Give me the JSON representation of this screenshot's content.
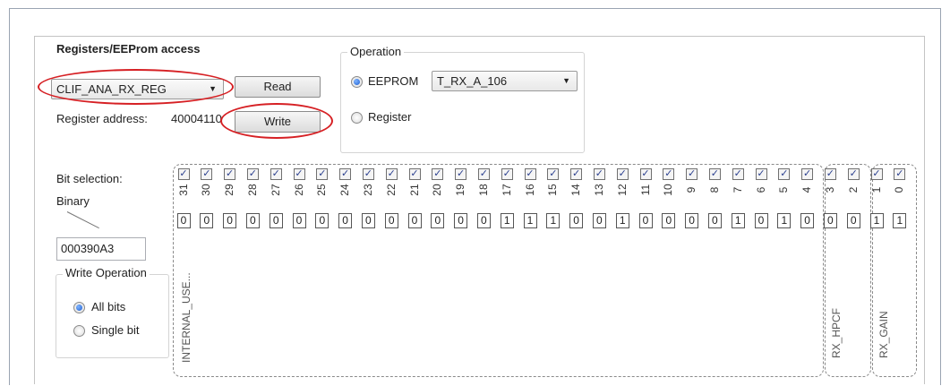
{
  "registers": {
    "title": "Registers/EEProm access",
    "register_select": "CLIF_ANA_RX_REG",
    "read_label": "Read",
    "write_label": "Write",
    "address_label": "Register address:",
    "address_value": "40004110"
  },
  "operation": {
    "legend": "Operation",
    "eeprom_label": "EEPROM",
    "eeprom_selected": true,
    "eeprom_select": "T_RX_A_106",
    "register_label": "Register",
    "register_selected": false
  },
  "bit_selection": {
    "label": "Bit selection:",
    "format_label": "Binary",
    "value": "000390A3",
    "bits": [
      {
        "n": "31",
        "v": "0",
        "checked": true
      },
      {
        "n": "30",
        "v": "0",
        "checked": true
      },
      {
        "n": "29",
        "v": "0",
        "checked": true
      },
      {
        "n": "28",
        "v": "0",
        "checked": true
      },
      {
        "n": "27",
        "v": "0",
        "checked": true
      },
      {
        "n": "26",
        "v": "0",
        "checked": true
      },
      {
        "n": "25",
        "v": "0",
        "checked": true
      },
      {
        "n": "24",
        "v": "0",
        "checked": true
      },
      {
        "n": "23",
        "v": "0",
        "checked": true
      },
      {
        "n": "22",
        "v": "0",
        "checked": true
      },
      {
        "n": "21",
        "v": "0",
        "checked": true
      },
      {
        "n": "20",
        "v": "0",
        "checked": true
      },
      {
        "n": "19",
        "v": "0",
        "checked": true
      },
      {
        "n": "18",
        "v": "0",
        "checked": true
      },
      {
        "n": "17",
        "v": "1",
        "checked": true
      },
      {
        "n": "16",
        "v": "1",
        "checked": true
      },
      {
        "n": "15",
        "v": "1",
        "checked": true
      },
      {
        "n": "14",
        "v": "0",
        "checked": true
      },
      {
        "n": "13",
        "v": "0",
        "checked": true
      },
      {
        "n": "12",
        "v": "1",
        "checked": true
      },
      {
        "n": "11",
        "v": "0",
        "checked": true
      },
      {
        "n": "10",
        "v": "0",
        "checked": true
      },
      {
        "n": "9",
        "v": "0",
        "checked": true
      },
      {
        "n": "8",
        "v": "0",
        "checked": true
      },
      {
        "n": "7",
        "v": "1",
        "checked": true
      },
      {
        "n": "6",
        "v": "0",
        "checked": true
      },
      {
        "n": "5",
        "v": "1",
        "checked": true
      },
      {
        "n": "4",
        "v": "0",
        "checked": true
      },
      {
        "n": "3",
        "v": "0",
        "checked": true
      },
      {
        "n": "2",
        "v": "0",
        "checked": true
      },
      {
        "n": "1",
        "v": "1",
        "checked": true
      },
      {
        "n": "0",
        "v": "1",
        "checked": true
      }
    ],
    "groups": [
      {
        "label": "INTERNAL_USE..."
      },
      {
        "label": "RX_HPCF"
      },
      {
        "label": "RX_GAIN"
      }
    ]
  },
  "write_operation": {
    "legend": "Write Operation",
    "all_bits_label": "All bits",
    "all_bits_selected": true,
    "single_bit_label": "Single bit",
    "single_bit_selected": false
  },
  "annotation_color": "#d62024"
}
